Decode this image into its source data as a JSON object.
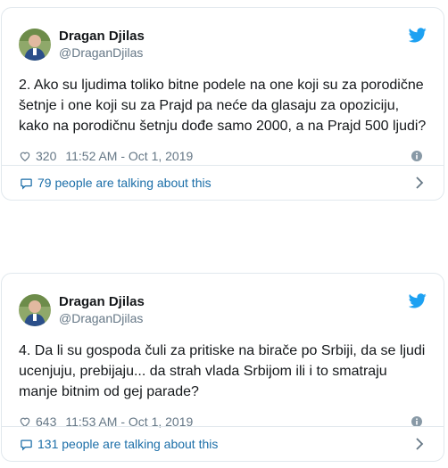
{
  "tweets": [
    {
      "display_name": "Dragan Djilas",
      "handle": "@DraganDjilas",
      "text": "2. Ako su ljudima toliko bitne podele na one koji su za porodične šetnje i one koji su za Prajd pa neće da glasaju za opoziciju, kako na porodičnu šetnju dođe samo 2000, a na Prajd 500 ljudi?",
      "likes": "320",
      "timestamp": "11:52 AM - Oct 1, 2019",
      "talking": "79 people are talking about this"
    },
    {
      "display_name": "Dragan Djilas",
      "handle": "@DraganDjilas",
      "text": "4. Da li su gospoda čuli za pritiske na birače po Srbiji, da se ljudi ucenjuju, prebijaju... da strah vlada Srbijom ili i to smatraju manje bitnim od gej parade?",
      "likes": "643",
      "timestamp": "11:53 AM - Oct 1, 2019",
      "talking": "131 people are talking about this"
    }
  ],
  "icons": {
    "brand": "twitter-bird-icon",
    "like": "heart-icon",
    "info": "info-icon",
    "comment": "speech-bubble-icon",
    "more": "chevron-right-icon"
  },
  "colors": {
    "twitter_blue": "#1da1f2",
    "link_blue": "#1b6ea8",
    "secondary_text": "#657786",
    "border": "#e1e8ed"
  }
}
